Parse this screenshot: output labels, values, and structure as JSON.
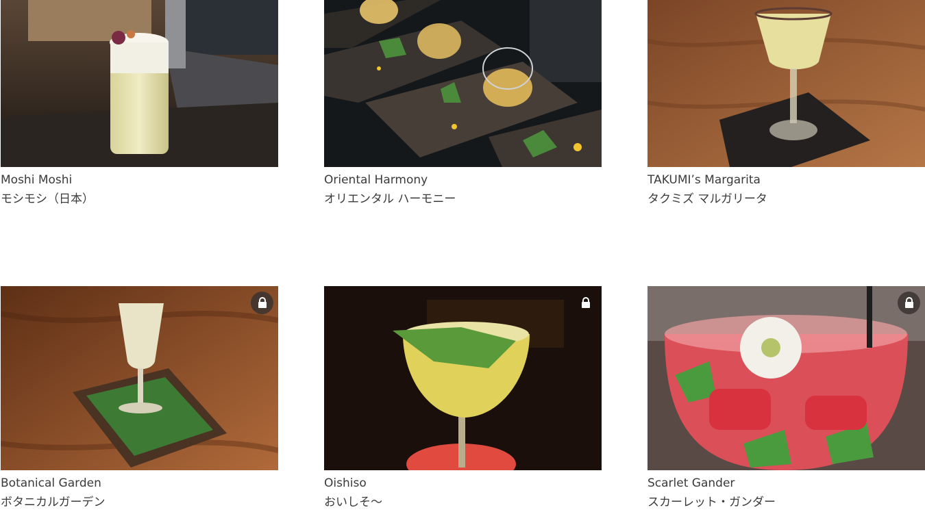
{
  "drinks": [
    {
      "name": "Moshi Moshi",
      "jp": "モシモシ（日本）",
      "locked": false
    },
    {
      "name": "Oriental Harmony",
      "jp": "オリエンタル ハーモニー",
      "locked": false
    },
    {
      "name": "TAKUMI’s Margarita",
      "jp": "タクミズ マルガリータ",
      "locked": false
    },
    {
      "name": "Botanical Garden",
      "jp": "ボタニカルガーデン",
      "locked": true
    },
    {
      "name": "Oishiso",
      "jp": "おいしそ〜",
      "locked": true
    },
    {
      "name": "Scarlet Gander",
      "jp": "スカーレット・ガンダー",
      "locked": true
    }
  ],
  "icons": {
    "lock": "lock-icon"
  },
  "colors": {
    "caption_text": "#3a3a3a",
    "lock_badge": "#3a3430"
  }
}
